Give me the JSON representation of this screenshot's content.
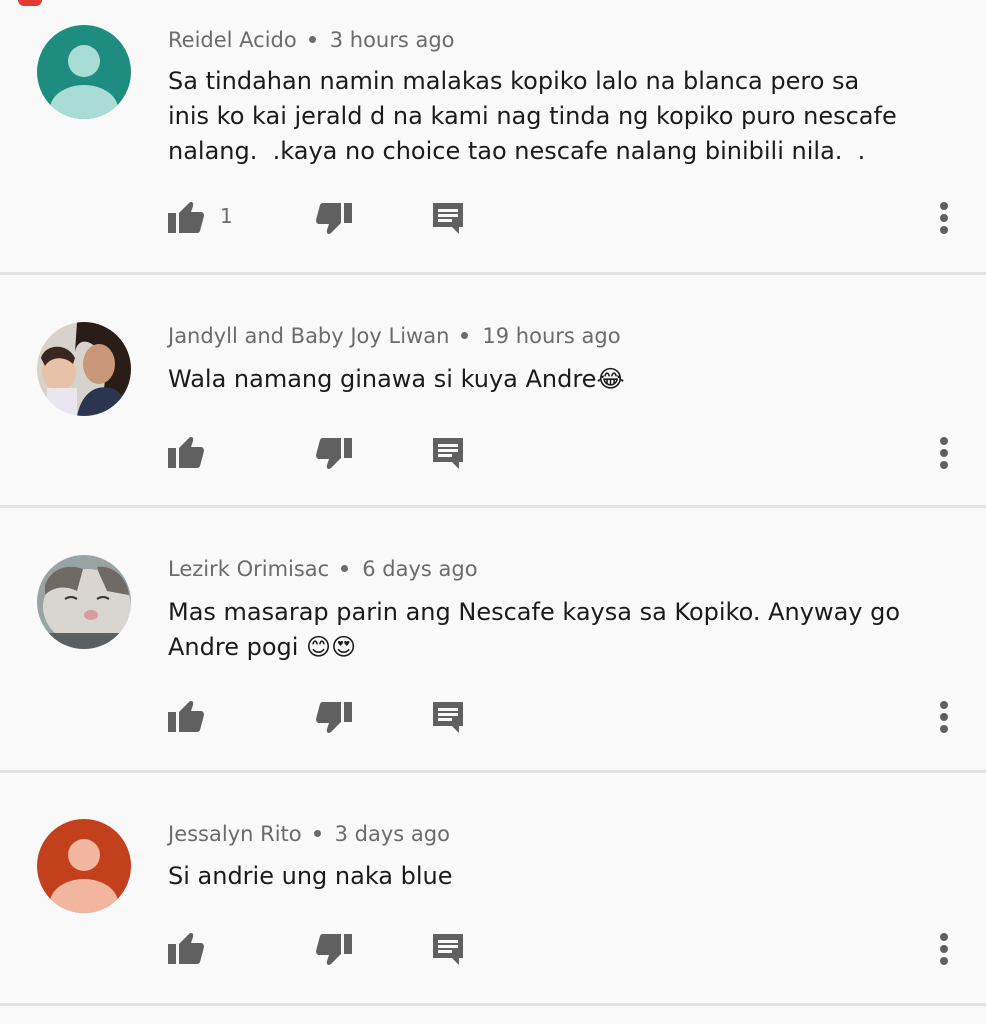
{
  "comments": [
    {
      "author": "Reidel Acido",
      "time": "3 hours ago",
      "text": "Sa tindahan namin malakas kopiko lalo na blanca pero sa\ninis ko kai jerald d na kami nag tinda ng kopiko puro nescafe\nnalang.  .kaya no choice tao nescafe nalang binibili nila.  .",
      "likes": "1",
      "avatar_color": "#1e8c80"
    },
    {
      "author": "Jandyll and Baby Joy Liwan",
      "time": "19 hours ago",
      "text": "Wala namang ginawa si kuya Andre😂",
      "likes": "",
      "avatar_color": "#6b4a3a"
    },
    {
      "author": "Lezirk Orimisac",
      "time": "6 days ago",
      "text": "Mas masarap parin ang Nescafe kaysa sa Kopiko. Anyway go\nAndre pogi 😊😍",
      "likes": "",
      "avatar_color": "#8a8f8c"
    },
    {
      "author": "Jessalyn Rito",
      "time": "3 days ago",
      "text": "Si andrie ung naka blue",
      "likes": "",
      "avatar_color": "#c2401c"
    }
  ],
  "icons": {
    "like": "thumb-up-icon",
    "dislike": "thumb-down-icon",
    "reply": "comment-icon",
    "more": "more-vert-icon"
  },
  "colors": {
    "icon": "#606060",
    "divider": "#e3e3e3",
    "background": "#f9f9f9"
  }
}
